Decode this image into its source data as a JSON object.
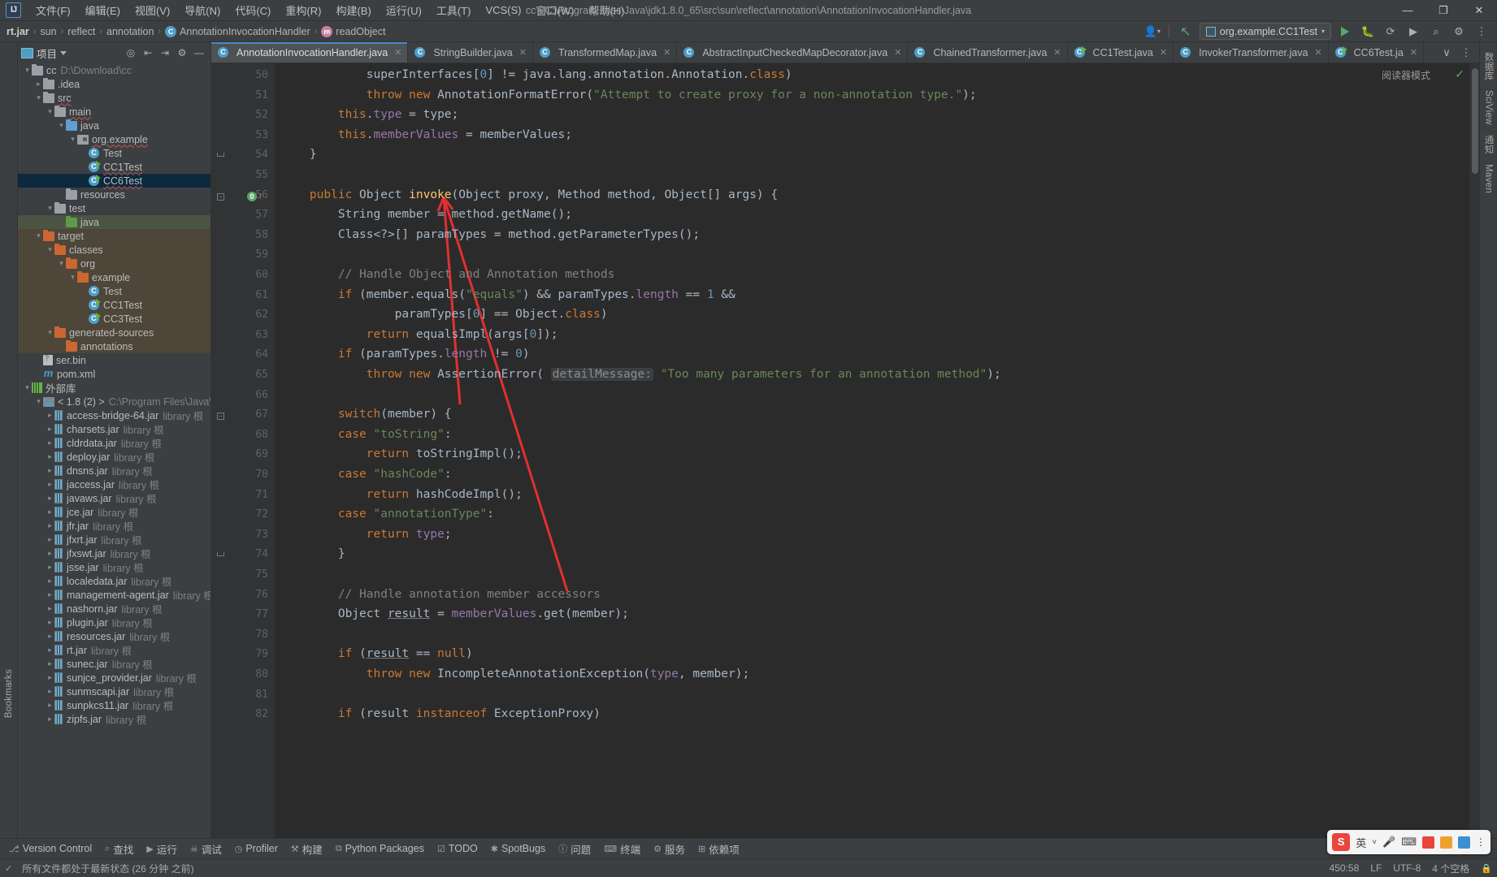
{
  "window": {
    "title": "cc - C:\\Program Files\\Java\\jdk1.8.0_65\\src\\sun\\reflect\\annotation\\AnnotationInvocationHandler.java",
    "minimize": "—",
    "maximize": "❐",
    "close": "✕",
    "logo": "IJ"
  },
  "menu": {
    "items": [
      {
        "label": "文件(F)"
      },
      {
        "label": "编辑(E)"
      },
      {
        "label": "视图(V)"
      },
      {
        "label": "导航(N)"
      },
      {
        "label": "代码(C)"
      },
      {
        "label": "重构(R)"
      },
      {
        "label": "构建(B)"
      },
      {
        "label": "运行(U)"
      },
      {
        "label": "工具(T)"
      },
      {
        "label": "VCS(S)"
      },
      {
        "label": "窗口(W)"
      },
      {
        "label": "帮助(H)"
      }
    ]
  },
  "breadcrumb": {
    "items": [
      "rt.jar",
      "sun",
      "reflect",
      "annotation",
      "AnnotationInvocationHandler",
      "readObject"
    ],
    "class_icon": "C",
    "method_icon": "m",
    "separator": "›"
  },
  "toolbar": {
    "run_config": "org.example.CC1Test",
    "profile_icon": "⎇",
    "back_icon": "↖",
    "run_icon": "run-icon",
    "debug_icon": "☠",
    "coverage_icon": "↻",
    "more_icon": "⋮",
    "search_icon": "⌕",
    "settings_icon": "⚙"
  },
  "project_panel": {
    "title": "项目",
    "icons": [
      "locate-icon",
      "expand-icon",
      "collapse-icon",
      "settings-icon",
      "hide-icon"
    ],
    "tree": [
      {
        "depth": 0,
        "arrow": "v",
        "icon": "module",
        "label": "cc",
        "dim": "D:\\Download\\cc",
        "state": "normal"
      },
      {
        "depth": 1,
        "arrow": ">",
        "icon": "folder-gray",
        "label": ".idea",
        "dim": "",
        "state": "normal"
      },
      {
        "depth": 1,
        "arrow": "v",
        "icon": "folder-gray",
        "label": "src",
        "dim": "",
        "state": "normal",
        "squiggle": true
      },
      {
        "depth": 2,
        "arrow": "v",
        "icon": "folder-gray",
        "label": "main",
        "dim": "",
        "state": "normal",
        "squiggle": true
      },
      {
        "depth": 3,
        "arrow": "v",
        "icon": "folder-blue",
        "label": "java",
        "dim": "",
        "state": "normal"
      },
      {
        "depth": 4,
        "arrow": "v",
        "icon": "package",
        "label": "org.example",
        "dim": "",
        "state": "normal",
        "squiggle": true
      },
      {
        "depth": 5,
        "arrow": "",
        "icon": "class",
        "label": "Test",
        "dim": "",
        "state": "normal"
      },
      {
        "depth": 5,
        "arrow": "",
        "icon": "class-run",
        "label": "CC1Test",
        "dim": "",
        "state": "normal",
        "squiggle": true
      },
      {
        "depth": 5,
        "arrow": "",
        "icon": "class-run",
        "label": "CC6Test",
        "dim": "",
        "state": "selected",
        "squiggle": true
      },
      {
        "depth": 3,
        "arrow": "",
        "icon": "folder-res",
        "label": "resources",
        "dim": "",
        "state": "normal"
      },
      {
        "depth": 2,
        "arrow": "v",
        "icon": "folder-gray",
        "label": "test",
        "dim": "",
        "state": "normal"
      },
      {
        "depth": 3,
        "arrow": "",
        "icon": "folder-green",
        "label": "java",
        "dim": "",
        "state": "green"
      },
      {
        "depth": 1,
        "arrow": "v",
        "icon": "folder-orange",
        "label": "target",
        "dim": "",
        "state": "target"
      },
      {
        "depth": 2,
        "arrow": "v",
        "icon": "folder-orange",
        "label": "classes",
        "dim": "",
        "state": "target"
      },
      {
        "depth": 3,
        "arrow": "v",
        "icon": "folder-orange",
        "label": "org",
        "dim": "",
        "state": "target"
      },
      {
        "depth": 4,
        "arrow": "v",
        "icon": "folder-orange",
        "label": "example",
        "dim": "",
        "state": "target"
      },
      {
        "depth": 5,
        "arrow": "",
        "icon": "class",
        "label": "Test",
        "dim": "",
        "state": "target"
      },
      {
        "depth": 5,
        "arrow": "",
        "icon": "class-run",
        "label": "CC1Test",
        "dim": "",
        "state": "target"
      },
      {
        "depth": 5,
        "arrow": "",
        "icon": "class-run",
        "label": "CC3Test",
        "dim": "",
        "state": "target"
      },
      {
        "depth": 2,
        "arrow": "v",
        "icon": "folder-orange",
        "label": "generated-sources",
        "dim": "",
        "state": "target"
      },
      {
        "depth": 3,
        "arrow": "",
        "icon": "folder-orange",
        "label": "annotations",
        "dim": "",
        "state": "target"
      },
      {
        "depth": 1,
        "arrow": "",
        "icon": "bin",
        "label": "ser.bin",
        "dim": "",
        "state": "normal"
      },
      {
        "depth": 1,
        "arrow": "",
        "icon": "maven",
        "label": "pom.xml",
        "dim": "",
        "state": "normal"
      },
      {
        "depth": 0,
        "arrow": "v",
        "icon": "library",
        "label": "外部库",
        "dim": "",
        "state": "normal"
      },
      {
        "depth": 1,
        "arrow": "v",
        "icon": "sdk",
        "label": "< 1.8 (2) >",
        "dim": "C:\\Program Files\\Java\\jdk",
        "state": "normal"
      },
      {
        "depth": 2,
        "arrow": ">",
        "icon": "jar",
        "label": "access-bridge-64.jar",
        "dim": "library 根",
        "state": "normal"
      },
      {
        "depth": 2,
        "arrow": ">",
        "icon": "jar",
        "label": "charsets.jar",
        "dim": "library 根",
        "state": "normal"
      },
      {
        "depth": 2,
        "arrow": ">",
        "icon": "jar",
        "label": "cldrdata.jar",
        "dim": "library 根",
        "state": "normal"
      },
      {
        "depth": 2,
        "arrow": ">",
        "icon": "jar",
        "label": "deploy.jar",
        "dim": "library 根",
        "state": "normal"
      },
      {
        "depth": 2,
        "arrow": ">",
        "icon": "jar",
        "label": "dnsns.jar",
        "dim": "library 根",
        "state": "normal"
      },
      {
        "depth": 2,
        "arrow": ">",
        "icon": "jar",
        "label": "jaccess.jar",
        "dim": "library 根",
        "state": "normal"
      },
      {
        "depth": 2,
        "arrow": ">",
        "icon": "jar",
        "label": "javaws.jar",
        "dim": "library 根",
        "state": "normal"
      },
      {
        "depth": 2,
        "arrow": ">",
        "icon": "jar",
        "label": "jce.jar",
        "dim": "library 根",
        "state": "normal"
      },
      {
        "depth": 2,
        "arrow": ">",
        "icon": "jar",
        "label": "jfr.jar",
        "dim": "library 根",
        "state": "normal"
      },
      {
        "depth": 2,
        "arrow": ">",
        "icon": "jar",
        "label": "jfxrt.jar",
        "dim": "library 根",
        "state": "normal"
      },
      {
        "depth": 2,
        "arrow": ">",
        "icon": "jar",
        "label": "jfxswt.jar",
        "dim": "library 根",
        "state": "normal"
      },
      {
        "depth": 2,
        "arrow": ">",
        "icon": "jar",
        "label": "jsse.jar",
        "dim": "library 根",
        "state": "normal"
      },
      {
        "depth": 2,
        "arrow": ">",
        "icon": "jar",
        "label": "localedata.jar",
        "dim": "library 根",
        "state": "normal"
      },
      {
        "depth": 2,
        "arrow": ">",
        "icon": "jar",
        "label": "management-agent.jar",
        "dim": "library 根",
        "state": "normal"
      },
      {
        "depth": 2,
        "arrow": ">",
        "icon": "jar",
        "label": "nashorn.jar",
        "dim": "library 根",
        "state": "normal"
      },
      {
        "depth": 2,
        "arrow": ">",
        "icon": "jar",
        "label": "plugin.jar",
        "dim": "library 根",
        "state": "normal"
      },
      {
        "depth": 2,
        "arrow": ">",
        "icon": "jar",
        "label": "resources.jar",
        "dim": "library 根",
        "state": "normal"
      },
      {
        "depth": 2,
        "arrow": ">",
        "icon": "jar",
        "label": "rt.jar",
        "dim": "library 根",
        "state": "normal"
      },
      {
        "depth": 2,
        "arrow": ">",
        "icon": "jar",
        "label": "sunec.jar",
        "dim": "library 根",
        "state": "normal"
      },
      {
        "depth": 2,
        "arrow": ">",
        "icon": "jar",
        "label": "sunjce_provider.jar",
        "dim": "library 根",
        "state": "normal"
      },
      {
        "depth": 2,
        "arrow": ">",
        "icon": "jar",
        "label": "sunmscapi.jar",
        "dim": "library 根",
        "state": "normal"
      },
      {
        "depth": 2,
        "arrow": ">",
        "icon": "jar",
        "label": "sunpkcs11.jar",
        "dim": "library 根",
        "state": "normal"
      },
      {
        "depth": 2,
        "arrow": ">",
        "icon": "jar",
        "label": "zipfs.jar",
        "dim": "library 根",
        "state": "normal"
      }
    ]
  },
  "left_strip": {
    "bookmarks": "Bookmarks"
  },
  "right_strip": {
    "items": [
      "数据库",
      "SciView",
      "通知",
      "Maven"
    ]
  },
  "tabs": {
    "items": [
      {
        "label": "AnnotationInvocationHandler.java",
        "icon": "class",
        "active": true
      },
      {
        "label": "StringBuilder.java",
        "icon": "class",
        "active": false
      },
      {
        "label": "TransformedMap.java",
        "icon": "class",
        "active": false
      },
      {
        "label": "AbstractInputCheckedMapDecorator.java",
        "icon": "class",
        "active": false
      },
      {
        "label": "ChainedTransformer.java",
        "icon": "class",
        "active": false
      },
      {
        "label": "CC1Test.java",
        "icon": "class-run",
        "active": false
      },
      {
        "label": "InvokerTransformer.java",
        "icon": "class",
        "active": false
      },
      {
        "label": "CC6Test.ja",
        "icon": "class-run",
        "active": false
      }
    ],
    "close_glyph": "✕",
    "overflow_glyph": "∨",
    "more_glyph": "⋮"
  },
  "editor": {
    "reading_mode": "阅读器模式",
    "inspection_ok": "✓",
    "first_line": 50,
    "lines": [
      {
        "n": 50,
        "html": "            superInterfaces[<span class=\"num\">0</span>] != java.lang.annotation.Annotation.<span class=\"kw\">class</span>)"
      },
      {
        "n": 51,
        "html": "            <span class=\"kw\">throw new</span> AnnotationFormatError(<span class=\"str\">\"Attempt to create proxy for a non-annotation type.\"</span>);"
      },
      {
        "n": 52,
        "html": "        <span class=\"kw\">this</span>.<span class=\"fld\">type</span> = type;"
      },
      {
        "n": 53,
        "html": "        <span class=\"kw\">this</span>.<span class=\"fld\">memberValues</span> = memberValues;"
      },
      {
        "n": 54,
        "html": "    }",
        "fold": "end"
      },
      {
        "n": 55,
        "html": ""
      },
      {
        "n": 56,
        "html": "    <span class=\"kw\">public</span> Object <span style=\"color:#ffc66d\">invoke</span>(Object proxy, Method method, Object[] args) {",
        "fold": "start",
        "marker": "warn"
      },
      {
        "n": 57,
        "html": "        String member = method.getName();"
      },
      {
        "n": 58,
        "html": "        Class&lt;?&gt;[] paramTypes = method.getParameterTypes();"
      },
      {
        "n": 59,
        "html": ""
      },
      {
        "n": 60,
        "html": "        <span class=\"cmt\">// Handle Object and Annotation methods</span>"
      },
      {
        "n": 61,
        "html": "        <span class=\"kw\">if</span> (member.equals(<span class=\"str\">\"equals\"</span>) &amp;&amp; paramTypes.<span class=\"fld\">length</span> == <span class=\"num\">1</span> &amp;&amp;"
      },
      {
        "n": 62,
        "html": "                paramTypes[<span class=\"num\">0</span>] == Object.<span class=\"kw\">class</span>)"
      },
      {
        "n": 63,
        "html": "            <span class=\"kw\">return</span> equalsImpl(args[<span class=\"num\">0</span>]);"
      },
      {
        "n": 64,
        "html": "        <span class=\"kw\">if</span> (paramTypes.<span class=\"fld\">length</span> != <span class=\"num\">0</span>)"
      },
      {
        "n": 65,
        "html": "            <span class=\"kw\">throw new</span> AssertionError( <span class=\"hintbox\">detailMessage:</span> <span class=\"str\">\"Too many parameters for an annotation method\"</span>);"
      },
      {
        "n": 66,
        "html": ""
      },
      {
        "n": 67,
        "html": "        <span class=\"kw\">switch</span>(member) {",
        "fold": "start"
      },
      {
        "n": 68,
        "html": "        <span class=\"kw\">case</span> <span class=\"str\">\"toString\"</span>:"
      },
      {
        "n": 69,
        "html": "            <span class=\"kw\">return</span> toStringImpl();"
      },
      {
        "n": 70,
        "html": "        <span class=\"kw\">case</span> <span class=\"str\">\"hashCode\"</span>:"
      },
      {
        "n": 71,
        "html": "            <span class=\"kw\">return</span> hashCodeImpl();"
      },
      {
        "n": 72,
        "html": "        <span class=\"kw\">case</span> <span class=\"str\">\"annotationType\"</span>:"
      },
      {
        "n": 73,
        "html": "            <span class=\"kw\">return</span> <span class=\"fld\">type</span>;"
      },
      {
        "n": 74,
        "html": "        }",
        "fold": "end"
      },
      {
        "n": 75,
        "html": ""
      },
      {
        "n": 76,
        "html": "        <span class=\"cmt\">// Handle annotation member accessors</span>"
      },
      {
        "n": 77,
        "html": "        Object <span class=\"undl\">result</span> = <span class=\"fld\">memberValues</span>.get(member);"
      },
      {
        "n": 78,
        "html": ""
      },
      {
        "n": 79,
        "html": "        <span class=\"kw\">if</span> (<span class=\"undl\">result</span> == <span class=\"kw\">null</span>)"
      },
      {
        "n": 80,
        "html": "            <span class=\"kw\">throw new</span> IncompleteAnnotationException(<span class=\"fld\">type</span>, member);"
      },
      {
        "n": 81,
        "html": ""
      },
      {
        "n": 82,
        "html": "        <span class=\"kw\">if</span> (result <span class=\"kw\">instanceof</span> ExceptionProxy)"
      }
    ]
  },
  "bottom_bar": {
    "items": [
      {
        "label": "Version Control",
        "icon": "⎇"
      },
      {
        "label": "查找",
        "icon": "⌕"
      },
      {
        "label": "运行",
        "icon": "▶"
      },
      {
        "label": "调试",
        "icon": "☠"
      },
      {
        "label": "Profiler",
        "icon": "◷"
      },
      {
        "label": "构建",
        "icon": "⚒"
      },
      {
        "label": "Python Packages",
        "icon": "⧉"
      },
      {
        "label": "TODO",
        "icon": "☑"
      },
      {
        "label": "SpotBugs",
        "icon": "✱"
      },
      {
        "label": "问题",
        "icon": "ⓘ"
      },
      {
        "label": "终端",
        "icon": "⌨"
      },
      {
        "label": "服务",
        "icon": "⚙"
      },
      {
        "label": "依赖项",
        "icon": "⊞"
      }
    ]
  },
  "status_bar": {
    "message": "所有文件都处于最新状态 (26 分钟 之前)",
    "caret": "450:58",
    "line_sep": "LF",
    "encoding": "UTF-8",
    "indent": "4 个空格",
    "lock_icon": "🔒"
  },
  "ime": {
    "logo": "S",
    "lang": "英",
    "dropdown": "˅",
    "mic_icon": "🎤",
    "keyboard_icon": "⌨",
    "tools": [
      "tool-red",
      "tool-orange",
      "tool-blue"
    ],
    "menu_icon": "⋮"
  },
  "colors": {
    "accent": "#4a88c7",
    "panel": "#3c3f41",
    "editor_bg": "#2b2b2b",
    "gutter_bg": "#313335",
    "selection": "#0d293e",
    "annotation_red": "#e03030",
    "keyword": "#cc7832",
    "string": "#6a8759",
    "number": "#6897bb",
    "field": "#9876aa",
    "comment": "#808080",
    "method": "#ffc66d"
  }
}
